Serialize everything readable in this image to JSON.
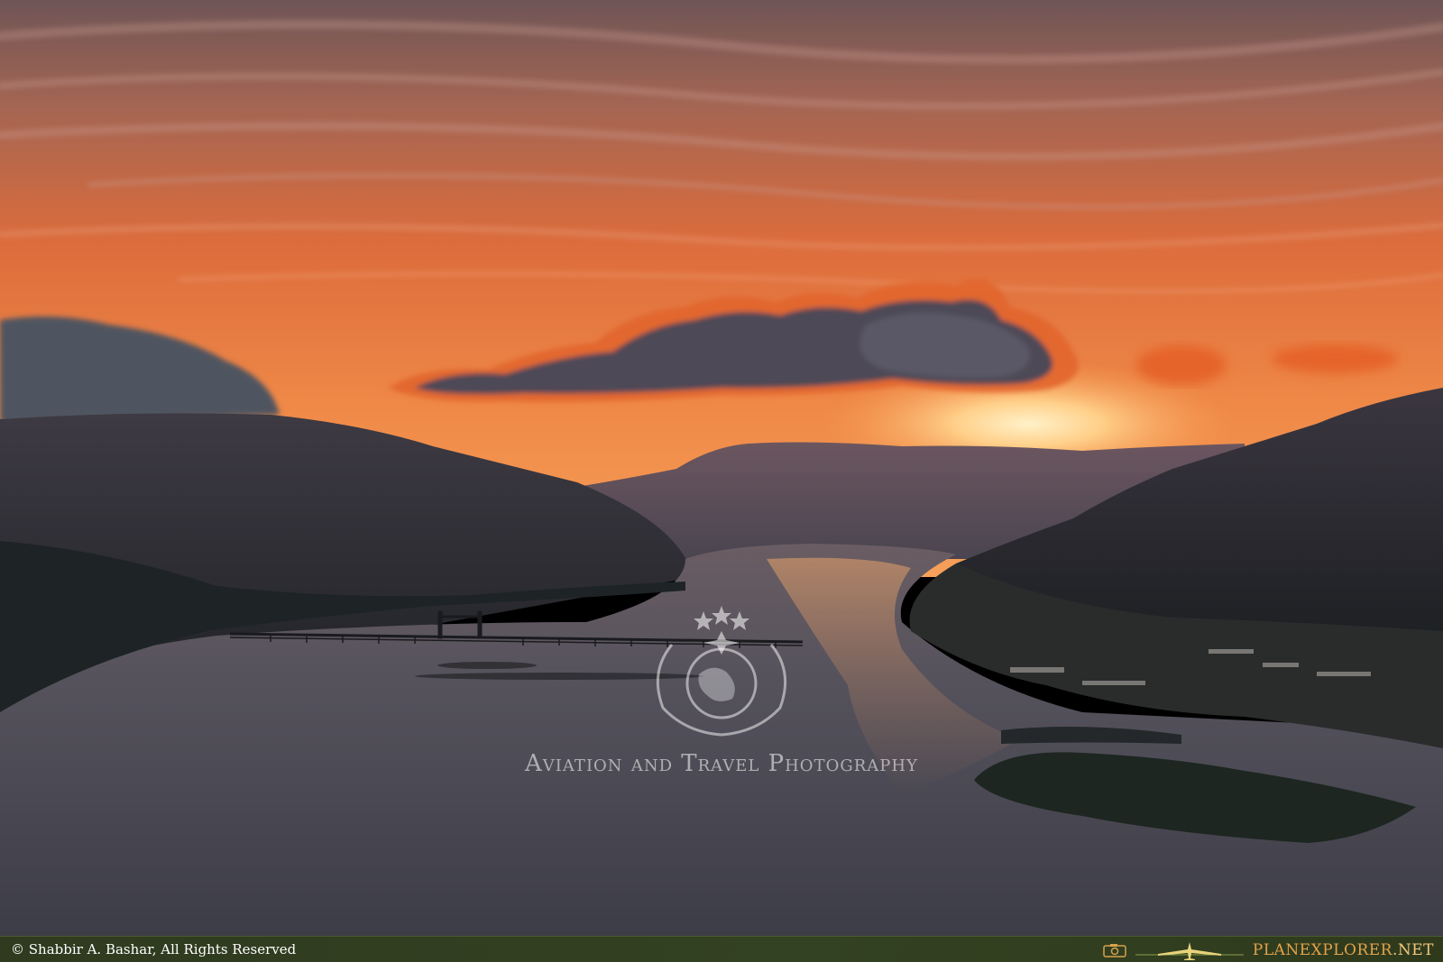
{
  "photo": {
    "alt": "Sunset over a river gorge with a long bridge, town on the right bank and an island",
    "colors": {
      "sky_top": "#7d5a55",
      "sky_mid": "#e0703e",
      "sky_glow": "#f4a15c",
      "sun": "#ffe0a6",
      "hills": "#2f2c33",
      "water": "#4f4c55",
      "water_reflection": "#c98a64"
    }
  },
  "watermark": {
    "caption": "Aviation and Travel Photography",
    "emblem_icon": "laurel-wreath-globe-icon"
  },
  "footer": {
    "copyright": "© Shabbir A. Bashar, All Rights Reserved",
    "brand_main": "PLANEXPLORER",
    "brand_tld": ".NET",
    "camera_icon": "camera-icon",
    "plane_icon": "airplane-icon"
  }
}
